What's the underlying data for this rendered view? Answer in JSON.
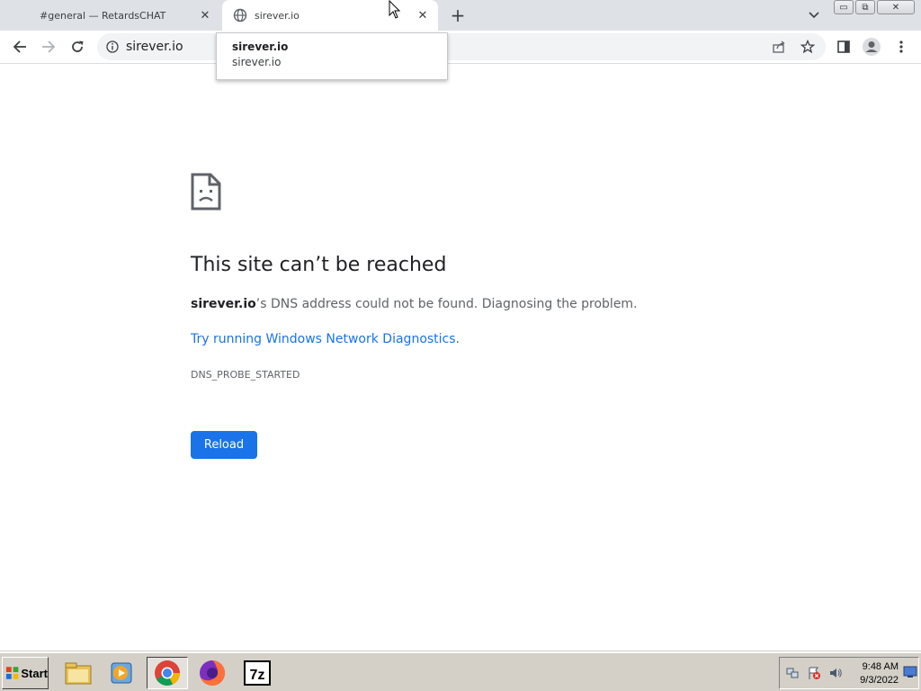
{
  "tabs": [
    {
      "title": "#general — RetardsCHAT",
      "close": "✕"
    },
    {
      "title": "sirever.io",
      "close": "✕"
    }
  ],
  "new_tab": "+",
  "window_buttons": {
    "minimize": "▭",
    "restore": "⧉",
    "close": "✕"
  },
  "omnibox": {
    "url": "sirever.io"
  },
  "hovercard": {
    "title": "sirever.io",
    "subtitle": "sirever.io"
  },
  "error": {
    "title": "This site can’t be reached",
    "host": "sirever.io",
    "desc_tail": "’s DNS address could not be found. Diagnosing the problem.",
    "link": "Try running Windows Network Diagnostics",
    "link_tail": ".",
    "code": "DNS_PROBE_STARTED",
    "reload": "Reload"
  },
  "taskbar": {
    "start": "Start",
    "apps": [
      "file-explorer-icon",
      "media-player-icon",
      "chrome-icon",
      "firefox-icon",
      "7zip-icon"
    ],
    "time": "9:48 AM",
    "date": "9/3/2022"
  },
  "colors": {
    "accent": "#1a73e8",
    "tabstrip": "#dee1e6",
    "taskbar": "#d4d0c8"
  }
}
